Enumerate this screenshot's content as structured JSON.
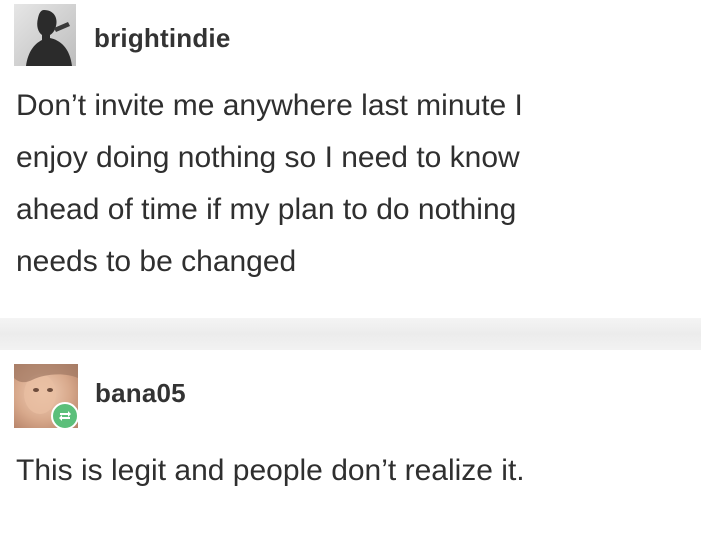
{
  "posts": [
    {
      "username": "brightindie",
      "text": "Don’t invite me anywhere last minute I\nenjoy doing nothing so I need to know\nahead of time if my plan to do nothing\nneeds to be changed",
      "avatar_icon": "person-silhouette-avatar"
    },
    {
      "username": "bana05",
      "text": "This is legit and people don’t realize it.",
      "avatar_icon": "photo-avatar",
      "badge_icon": "reblog-icon",
      "badge_color": "#5bbf7a"
    }
  ],
  "colors": {
    "text": "#2f2f2f",
    "divider": "#ececec",
    "background": "#ffffff"
  }
}
